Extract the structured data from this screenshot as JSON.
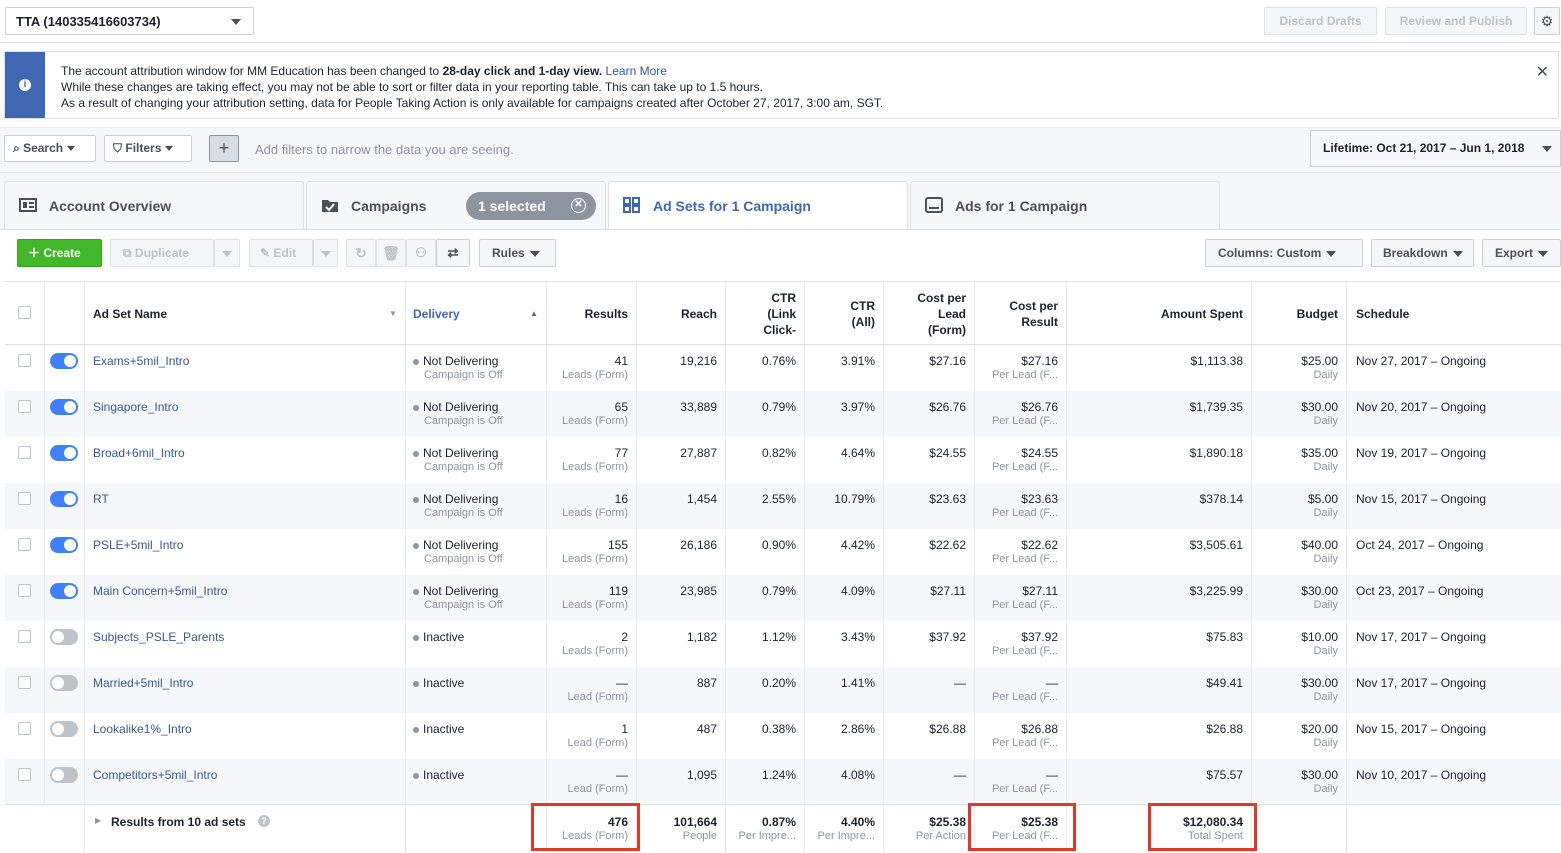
{
  "account": {
    "label": "TTA (140335416603734)"
  },
  "top_buttons": {
    "discard": "Discard Drafts",
    "review": "Review and Publish"
  },
  "notice": {
    "line1_pre": "The account attribution window for MM Education has been changed to ",
    "line1_bold": "28-day click and 1-day view.",
    "line1_link": "Learn More",
    "line2": "While these changes are taking effect, you may not be able to sort or filter data in your reporting table. This can take up to 1.5 hours.",
    "line3": "As a result of changing your attribution setting, data for People Taking Action is only available for campaigns created after October 27, 2017, 3:00 am, SGT."
  },
  "filters": {
    "search": "Search",
    "filters": "Filters",
    "hint": "Add filters to narrow the data you are seeing.",
    "date": "Lifetime: Oct 21, 2017 – Jun 1, 2018"
  },
  "tabs": [
    {
      "label": "Account Overview"
    },
    {
      "label": "Campaigns",
      "pill": "1 selected"
    },
    {
      "label": "Ad Sets for 1 Campaign"
    },
    {
      "label": "Ads for 1 Campaign"
    }
  ],
  "toolbar": {
    "create": "Create",
    "duplicate": "Duplicate",
    "edit": "Edit",
    "rules": "Rules",
    "columns": "Columns: Custom",
    "breakdown": "Breakdown",
    "export": "Export"
  },
  "columns": {
    "name": "Ad Set Name",
    "delivery": "Delivery",
    "results": "Results",
    "reach": "Reach",
    "ctr_link_1": "CTR",
    "ctr_link_2": "(Link",
    "ctr_link_3": "Click-",
    "ctr_all_1": "CTR",
    "ctr_all_2": "(All)",
    "cpl_1": "Cost per",
    "cpl_2": "Lead",
    "cpl_3": "(Form)",
    "cpr_1": "Cost per",
    "cpr_2": "Result",
    "spent": "Amount Spent",
    "budget": "Budget",
    "schedule": "Schedule"
  },
  "rows": [
    {
      "name": "Exams+5mil_Intro",
      "on": true,
      "delivery": "Not Delivering",
      "delivery_sub": "Campaign is Off",
      "results": "41",
      "results_sub": "Leads (Form)",
      "reach": "19,216",
      "ctr_link": "0.76%",
      "ctr_all": "3.91%",
      "cpl": "$27.16",
      "cpr": "$27.16",
      "cpr_sub": "Per Lead (F...",
      "spent": "$1,113.38",
      "budget": "$25.00",
      "budget_sub": "Daily",
      "schedule": "Nov 27, 2017 – Ongoing"
    },
    {
      "name": "Singapore_Intro",
      "on": true,
      "delivery": "Not Delivering",
      "delivery_sub": "Campaign is Off",
      "results": "65",
      "results_sub": "Leads (Form)",
      "reach": "33,889",
      "ctr_link": "0.79%",
      "ctr_all": "3.97%",
      "cpl": "$26.76",
      "cpr": "$26.76",
      "cpr_sub": "Per Lead (F...",
      "spent": "$1,739.35",
      "budget": "$30.00",
      "budget_sub": "Daily",
      "schedule": "Nov 20, 2017 – Ongoing"
    },
    {
      "name": "Broad+6mil_Intro",
      "on": true,
      "delivery": "Not Delivering",
      "delivery_sub": "Campaign is Off",
      "results": "77",
      "results_sub": "Leads (Form)",
      "reach": "27,887",
      "ctr_link": "0.82%",
      "ctr_all": "4.64%",
      "cpl": "$24.55",
      "cpr": "$24.55",
      "cpr_sub": "Per Lead (F...",
      "spent": "$1,890.18",
      "budget": "$35.00",
      "budget_sub": "Daily",
      "schedule": "Nov 19, 2017 – Ongoing"
    },
    {
      "name": "RT",
      "on": true,
      "delivery": "Not Delivering",
      "delivery_sub": "Campaign is Off",
      "results": "16",
      "results_sub": "Leads (Form)",
      "reach": "1,454",
      "ctr_link": "2.55%",
      "ctr_all": "10.79%",
      "cpl": "$23.63",
      "cpr": "$23.63",
      "cpr_sub": "Per Lead (F...",
      "spent": "$378.14",
      "budget": "$5.00",
      "budget_sub": "Daily",
      "schedule": "Nov 15, 2017 – Ongoing"
    },
    {
      "name": "PSLE+5mil_Intro",
      "on": true,
      "delivery": "Not Delivering",
      "delivery_sub": "Campaign is Off",
      "results": "155",
      "results_sub": "Leads (Form)",
      "reach": "26,186",
      "ctr_link": "0.90%",
      "ctr_all": "4.42%",
      "cpl": "$22.62",
      "cpr": "$22.62",
      "cpr_sub": "Per Lead (F...",
      "spent": "$3,505.61",
      "budget": "$40.00",
      "budget_sub": "Daily",
      "schedule": "Oct 24, 2017 – Ongoing"
    },
    {
      "name": "Main Concern+5mil_Intro",
      "on": true,
      "delivery": "Not Delivering",
      "delivery_sub": "Campaign is Off",
      "results": "119",
      "results_sub": "Leads (Form)",
      "reach": "23,985",
      "ctr_link": "0.79%",
      "ctr_all": "4.09%",
      "cpl": "$27.11",
      "cpr": "$27.11",
      "cpr_sub": "Per Lead (F...",
      "spent": "$3,225.99",
      "budget": "$30.00",
      "budget_sub": "Daily",
      "schedule": "Oct 23, 2017 – Ongoing"
    },
    {
      "name": "Subjects_PSLE_Parents",
      "on": false,
      "delivery": "Inactive",
      "delivery_sub": "",
      "results": "2",
      "results_sub": "Leads (Form)",
      "reach": "1,182",
      "ctr_link": "1.12%",
      "ctr_all": "3.43%",
      "cpl": "$37.92",
      "cpr": "$37.92",
      "cpr_sub": "Per Lead (F...",
      "spent": "$75.83",
      "budget": "$10.00",
      "budget_sub": "Daily",
      "schedule": "Nov 17, 2017 – Ongoing"
    },
    {
      "name": "Married+5mil_Intro",
      "on": false,
      "delivery": "Inactive",
      "delivery_sub": "",
      "results": "—",
      "results_sub": "Lead (Form)",
      "reach": "887",
      "ctr_link": "0.20%",
      "ctr_all": "1.41%",
      "cpl": "—",
      "cpr": "—",
      "cpr_sub": "Per Lead (F...",
      "spent": "$49.41",
      "budget": "$30.00",
      "budget_sub": "Daily",
      "schedule": "Nov 17, 2017 – Ongoing"
    },
    {
      "name": "Lookalike1%_Intro",
      "on": false,
      "delivery": "Inactive",
      "delivery_sub": "",
      "results": "1",
      "results_sub": "Lead (Form)",
      "reach": "487",
      "ctr_link": "0.38%",
      "ctr_all": "2.86%",
      "cpl": "$26.88",
      "cpr": "$26.88",
      "cpr_sub": "Per Lead (F...",
      "spent": "$26.88",
      "budget": "$20.00",
      "budget_sub": "Daily",
      "schedule": "Nov 15, 2017 – Ongoing"
    },
    {
      "name": "Competitors+5mil_Intro",
      "on": false,
      "delivery": "Inactive",
      "delivery_sub": "",
      "results": "—",
      "results_sub": "Lead (Form)",
      "reach": "1,095",
      "ctr_link": "1.24%",
      "ctr_all": "4.08%",
      "cpl": "—",
      "cpr": "—",
      "cpr_sub": "Per Lead (F...",
      "spent": "$75.57",
      "budget": "$30.00",
      "budget_sub": "Daily",
      "schedule": "Nov 10, 2017 – Ongoing"
    }
  ],
  "totals": {
    "label": "Results from 10 ad sets",
    "results": "476",
    "results_sub": "Leads (Form)",
    "reach": "101,664",
    "reach_sub": "People",
    "ctr_link": "0.87%",
    "ctr_link_sub": "Per Impre...",
    "ctr_all": "4.40%",
    "ctr_all_sub": "Per Impre...",
    "cpl": "$25.38",
    "cpl_sub": "Per Action",
    "cpr": "$25.38",
    "cpr_sub": "Per Lead (F...",
    "spent": "$12,080.34",
    "spent_sub": "Total Spent"
  },
  "colors": {
    "brand": "#4267b2",
    "create": "#42b72a",
    "toggle_on": "#4080ff",
    "highlight": "#e0392b",
    "link": "#365899"
  }
}
